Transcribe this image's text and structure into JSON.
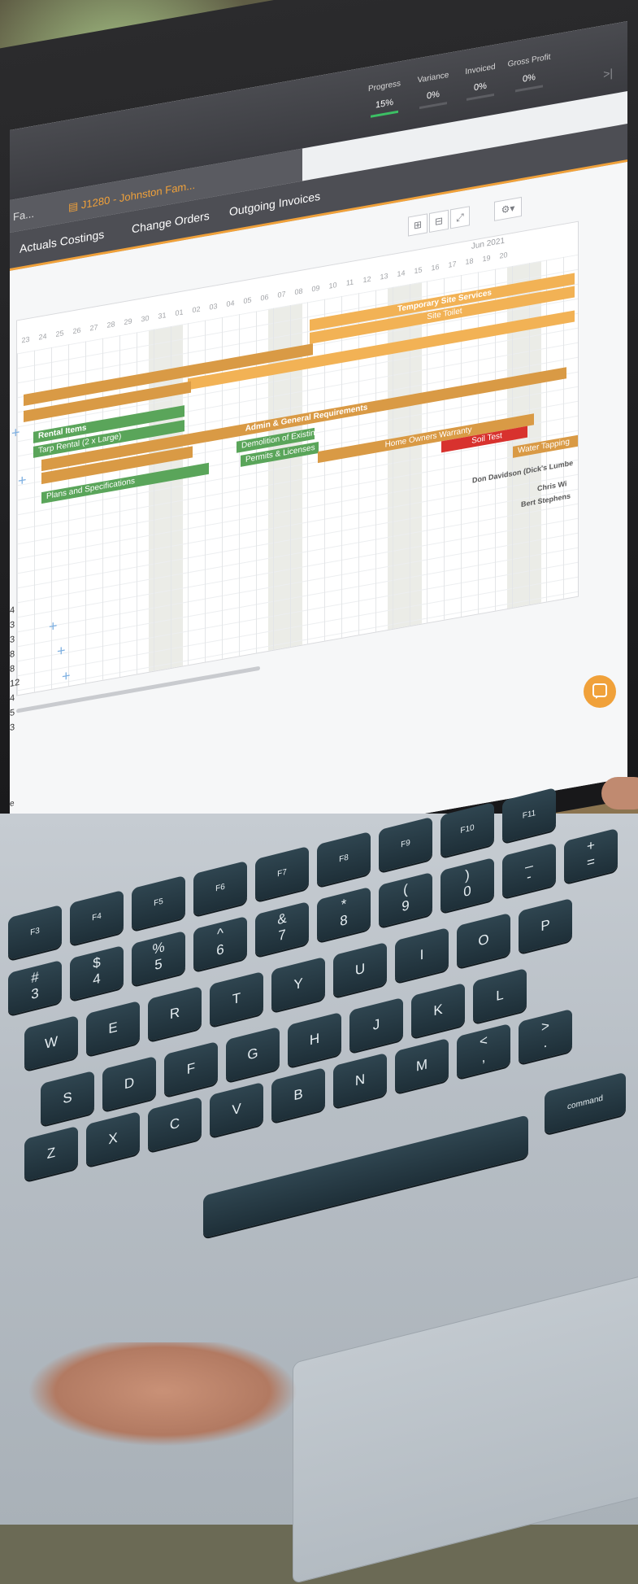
{
  "header": {
    "stats": [
      {
        "label": "Progress",
        "value": "15%"
      },
      {
        "label": "Variance",
        "value": "0%"
      },
      {
        "label": "Invoiced",
        "value": "0%"
      },
      {
        "label": "Gross Profit",
        "value": "0%"
      }
    ],
    "collapse_icon": ">|"
  },
  "job": {
    "prev_tab": "Fa...",
    "current_tab": "J1280 - Johnston Fam..."
  },
  "tabs": [
    "Actuals Costings",
    "Change Orders",
    "Outgoing Invoices"
  ],
  "toolbar": {
    "zoom_in_icon": "zoom-in-icon",
    "zoom_out_icon": "zoom-out-icon",
    "fullscreen_icon": "expand-icon",
    "settings_icon": "gear-icon"
  },
  "gantt": {
    "month": "Jun 2021",
    "days": [
      "23",
      "24",
      "25",
      "26",
      "27",
      "28",
      "29",
      "30",
      "31",
      "01",
      "02",
      "03",
      "04",
      "05",
      "06",
      "07",
      "08",
      "09",
      "10",
      "11",
      "12",
      "13",
      "14",
      "15",
      "16",
      "17",
      "18",
      "19",
      "20"
    ],
    "tasks": [
      {
        "label": "Temporary Site Services",
        "color": "#f2b255"
      },
      {
        "label": "Site Toilet",
        "color": "#f2b255"
      },
      {
        "label": "Rental Items",
        "color": "#5aa55a"
      },
      {
        "label": "Tarp Rental (2 x Large)",
        "color": "#5aa55a"
      },
      {
        "label": "Admin & General Requirements",
        "color": "#d99a45"
      },
      {
        "label": "Demolition of Existing",
        "color": "#5aa55a"
      },
      {
        "label": "Permits & Licenses",
        "color": "#5aa55a"
      },
      {
        "label": "Home Owners Warranty",
        "color": "#d99a45"
      },
      {
        "label": "Soil Test",
        "color": "#d8322e"
      },
      {
        "label": "Water Tapping",
        "color": "#d99a45"
      },
      {
        "label": "Plans and Specifications",
        "color": "#5aa55a"
      }
    ],
    "assignees": [
      "Don Davidson (Dick's Lumbe",
      "Chris Wi",
      "Bert Stephens"
    ]
  },
  "rows": [
    "4",
    "3",
    "3",
    "8",
    "8",
    "12",
    "4",
    "5",
    "3"
  ],
  "footer_char": "e",
  "chat_icon": "chat-icon",
  "keyboard": {
    "fn_row": [
      "F3",
      "F4",
      "F5",
      "F6",
      "F7",
      "F8",
      "F9",
      "F10",
      "F11"
    ],
    "num_row": [
      "#\n3",
      "$\n4",
      "%\n5",
      "^\n6",
      "&\n7",
      "*\n8",
      "(\n9",
      ")\n0",
      "_\n-",
      "+\n="
    ],
    "top_row": [
      "W",
      "E",
      "R",
      "T",
      "Y",
      "U",
      "I",
      "O",
      "P"
    ],
    "mid_row": [
      "S",
      "D",
      "F",
      "G",
      "H",
      "J",
      "K",
      "L"
    ],
    "bot_row": [
      "Z",
      "X",
      "C",
      "V",
      "B",
      "N",
      "M",
      "<\n,",
      ">\n."
    ],
    "command": "command"
  }
}
